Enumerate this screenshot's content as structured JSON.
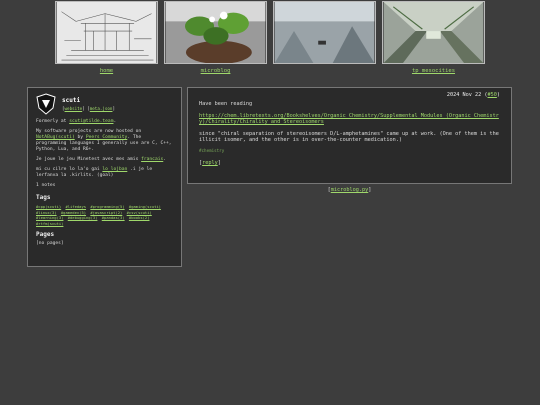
{
  "nav": {
    "items": [
      {
        "label": "home",
        "icon": "temple-sketch-image"
      },
      {
        "label": "microblog",
        "icon": "strawberry-plant-image"
      },
      {
        "label": "",
        "icon": "game-screenshot-image"
      },
      {
        "label": "tp mesocities",
        "icon": "train-interior-image"
      }
    ]
  },
  "profile": {
    "name": "scuti",
    "link_a": "website",
    "link_b": "meta.json",
    "formerly_prefix": "Formerly at ",
    "formerly_link": "scuti@tilde.team",
    "formerly_suffix": ".",
    "projects_prefix": "My software projects are now hosted on ",
    "projects_link1": "NotABug(scuti)",
    "projects_mid": " by ",
    "projects_link2": "Peers Community",
    "projects_suffix": ". The programming languages I generally use are C, C++, Python, Lua, and R6+.",
    "french_prefix": "Je joue le jeu Minetest avec mes amis ",
    "french_link": "francais",
    "french_suffix": ".",
    "lojban_prefix": "mi cu cilre lo la'o gai ",
    "lojban_link": "lo lojban",
    "lojban_suffix": " .i je le lerfanva la .kirlits. (goal)",
    "notes_count": "1 notes"
  },
  "tags": {
    "heading": "Tags",
    "items": [
      "#cpp(scuti)",
      "#lifedays",
      "#programming(5)",
      "#gaming(scuti)",
      "#linux(3)",
      "#gamedev(5)",
      "#javascript(2)",
      "#csv(scuti)",
      "#learning(3)",
      "#debugging(3)",
      "#pandas(3)",
      "#books(2)",
      "#rtfm(scuti)"
    ]
  },
  "pages": {
    "heading": "Pages",
    "empty": "[no pages]"
  },
  "post": {
    "date": "2024 Nov 22",
    "id": "#50",
    "body1": "Have been reading",
    "link": "https://chem.libretexts.org/Bookshelves/Organic_Chemistry/Supplemental_Modules_(Organic_Chemistry)/Chirality/Chirality_and_Stereoisomers",
    "body2": "since \"chiral separation of stereoisomers D/L-amphetamines\" came up at work. (One of them is the illicit isomer, and the other is in over-the-counter medication.)",
    "hashtag": "#chemistry",
    "reply": "reply"
  },
  "footer": {
    "link": "microblog.py"
  },
  "colors": {
    "background": "#3d3d3d",
    "panel": "#2a2a2a",
    "link": "#9fd86b"
  }
}
